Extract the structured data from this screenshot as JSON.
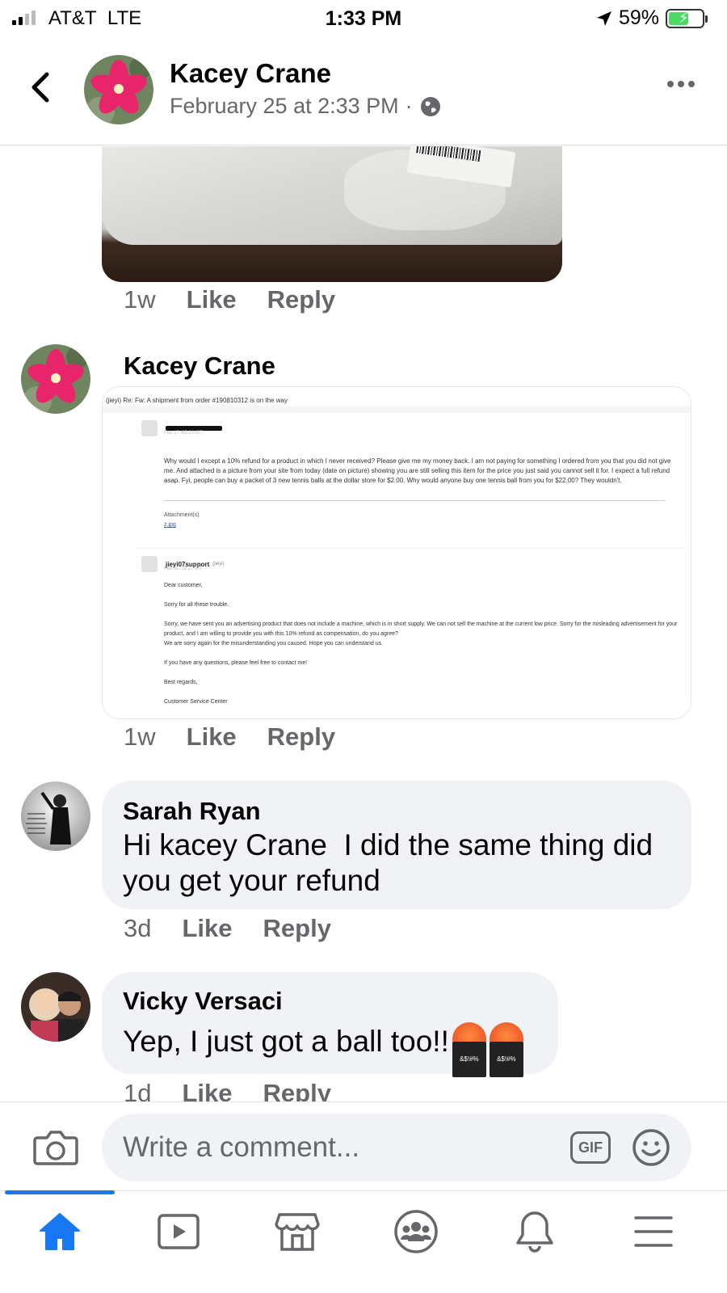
{
  "status_bar": {
    "carrier": "AT&T",
    "network": "LTE",
    "time": "1:33 PM",
    "battery": "59%",
    "battery_level": 0.59
  },
  "header": {
    "name": "Kacey Crane",
    "date": "February 25 at 2:33 PM",
    "separator": "·",
    "privacy_icon": "globe-icon"
  },
  "comments": [
    {
      "type": "photo",
      "time": "1w",
      "like": "Like",
      "reply": "Reply"
    },
    {
      "type": "image",
      "name": "Kacey Crane",
      "time": "1w",
      "like": "Like",
      "reply": "Reply",
      "screenshot": {
        "subject": "(jieyi) Re: Fw: A shipment from order #190810312 is on the way",
        "first_date": "Feb 17, 05:23 IST",
        "first_body": "Why would I except a 10% refund for a product in which I never received? Please give me my money back. I am not paying for something I ordered from you that you did not give me. And attached is a picture from your site from today (date on picture) showing you are still selling this item for the price you just said you cannot sell it for. I expect a full refund asap. Fyi, people can buy a packet of 3 new tennis balls at the dollar store for $2.00. Why would anyone buy one tennis ball from you for $22.00? They wouldn't.",
        "attachments_label": "Attachment(s)",
        "attachment": "z.jpg",
        "reply_sender": "jieyi07support",
        "reply_sender_tag": "(jieyi)",
        "reply_date": "Feb 11, 22:27 IST",
        "greeting": "Dear customer,",
        "line1": "Sorry for all these trouble.",
        "line2": "Sorry, we have sent you an advertising product that does not include a machine, which is in short supply. We can not sell the machine at the current low price. Sorry for the misleading advertisement for your product, and I am willing to provide you with this 10% refund as compensation, do you agree?",
        "line3": "We are sorry again for the misunderstanding you caused. Hope you can understand us.",
        "line4": "If you have any questions, please feel free to contact me!",
        "signoff": "Best regards,",
        "signature": "Customer Service Center"
      }
    },
    {
      "type": "text",
      "name": "Sarah Ryan",
      "text_line1": "Hi kacey Crane  I did the same thing did",
      "text_line2": "you get your refund",
      "time": "3d",
      "like": "Like",
      "reply": "Reply"
    },
    {
      "type": "text",
      "name": "Vicky Versaci",
      "text": "Yep, I just got a ball too!!",
      "emojis": [
        "cursing-face-emoji",
        "cursing-face-emoji"
      ],
      "time": "1d",
      "like": "Like",
      "reply": "Reply"
    }
  ],
  "composer": {
    "placeholder": "Write a comment...",
    "gif_label": "GIF"
  },
  "tab_bar": {
    "tabs": [
      "home-icon",
      "watch-icon",
      "marketplace-icon",
      "groups-icon",
      "notifications-icon",
      "menu-icon"
    ],
    "active": "home-icon",
    "accent": "#1877f2"
  }
}
